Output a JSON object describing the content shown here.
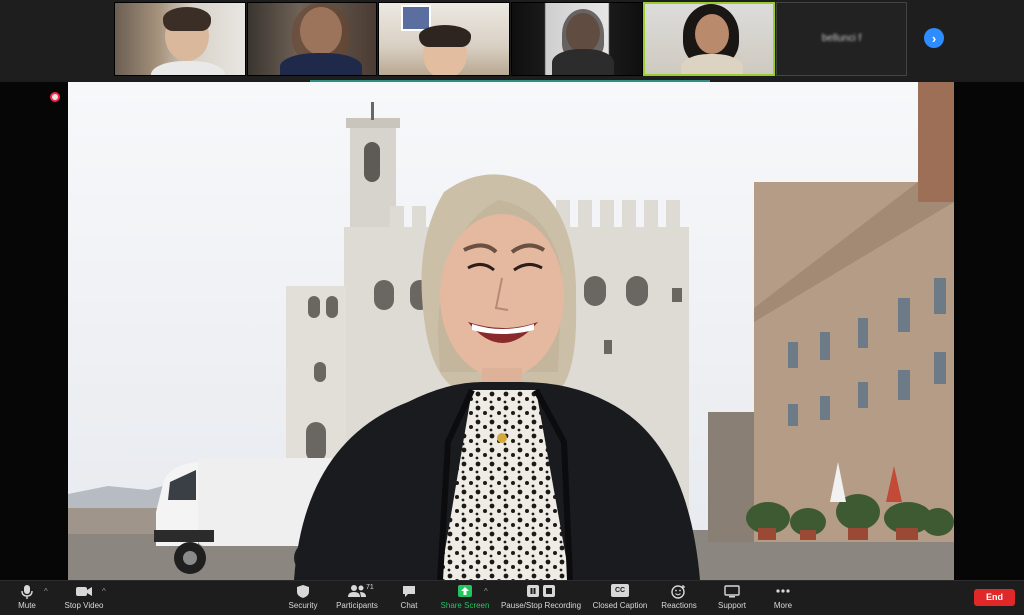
{
  "gallery": {
    "participants": [
      {
        "id": "p1"
      },
      {
        "id": "p2"
      },
      {
        "id": "p3"
      },
      {
        "id": "p4"
      },
      {
        "id": "p5",
        "active": true
      },
      {
        "id": "p6",
        "name": "bellunci f"
      }
    ],
    "next_icon": "chevron-right-icon"
  },
  "toolbar": {
    "mute": "Mute",
    "stop_video": "Stop Video",
    "security": "Security",
    "participants": "Participants",
    "participant_count": "71",
    "chat": "Chat",
    "share_screen": "Share Screen",
    "recording": "Pause/Stop Recording",
    "closed_caption": "Closed Caption",
    "closed_caption_badge": "CC",
    "reactions": "Reactions",
    "support": "Support",
    "more": "More",
    "end": "End"
  },
  "colors": {
    "accent_blue": "#2d8cff",
    "share_green": "#22c55e",
    "end_red": "#e02828",
    "active_border": "#9acd32"
  }
}
